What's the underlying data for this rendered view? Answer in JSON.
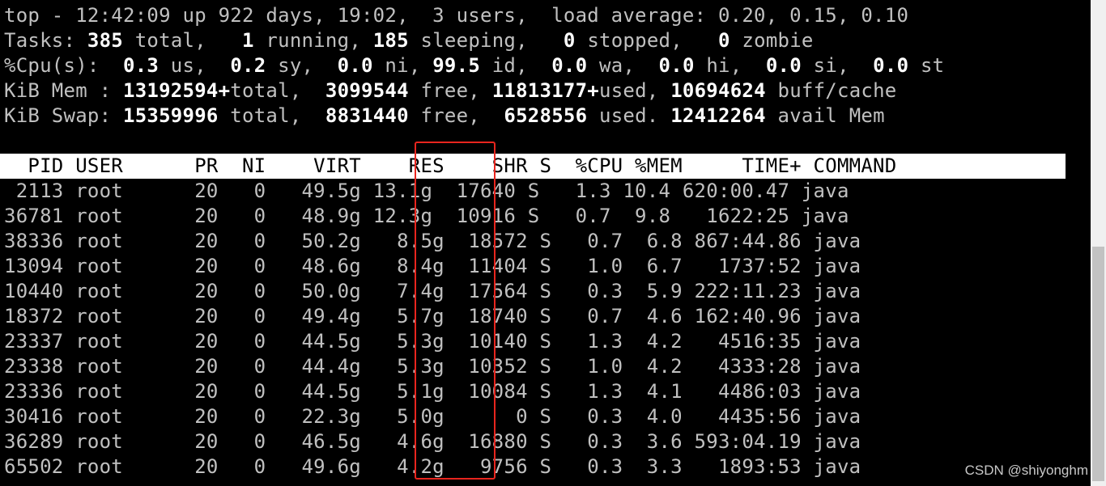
{
  "summary": {
    "uptime_line": "top - 12:42:09 up 922 days, 19:02,  3 users,  load average: 0.20, 0.15, 0.10",
    "tasks": {
      "label": "Tasks: ",
      "total": "385",
      "total_lbl": " total,   ",
      "running": "1",
      "running_lbl": " running, ",
      "sleeping": "185",
      "sleeping_lbl": " sleeping,   ",
      "stopped": "0",
      "stopped_lbl": " stopped,   ",
      "zombie": "0",
      "zombie_lbl": " zombie"
    },
    "cpu": {
      "label": "%Cpu(s):  ",
      "us": "0.3",
      "us_lbl": " us,  ",
      "sy": "0.2",
      "sy_lbl": " sy,  ",
      "ni": "0.0",
      "ni_lbl": " ni, ",
      "id": "99.5",
      "id_lbl": " id,  ",
      "wa": "0.0",
      "wa_lbl": " wa,  ",
      "hi": "0.0",
      "hi_lbl": " hi,  ",
      "si": "0.0",
      "si_lbl": " si,  ",
      "st": "0.0",
      "st_lbl": " st"
    },
    "mem": {
      "label": "KiB Mem : ",
      "total": "13192594+",
      "total_lbl": "total,  ",
      "free": "3099544",
      "free_lbl": " free, ",
      "used": "11813177+",
      "used_lbl": "used, ",
      "buff": "10694624",
      "buff_lbl": " buff/cache"
    },
    "swap": {
      "label": "KiB Swap: ",
      "total": "15359996",
      "total_lbl": " total,  ",
      "free": "8831440",
      "free_lbl": " free,  ",
      "used": "6528556",
      "used_lbl": " used. ",
      "avail": "12412264",
      "avail_lbl": " avail Mem"
    }
  },
  "table": {
    "header": "  PID USER      PR  NI    VIRT    RES    SHR S  %CPU %MEM     TIME+ COMMAND",
    "rows": [
      " 2113 root      20   0   49.5g 13.1g  17640 S   1.3 10.4 620:00.47 java",
      "36781 root      20   0   48.9g 12.3g  10916 S   0.7  9.8   1622:25 java",
      "38336 root      20   0   50.2g   8.5g  18572 S   0.7  6.8 867:44.86 java",
      "13094 root      20   0   48.6g   8.4g  11404 S   1.0  6.7   1737:52 java",
      "10440 root      20   0   50.0g   7.4g  17564 S   0.3  5.9 222:11.23 java",
      "18372 root      20   0   49.4g   5.7g  18740 S   0.7  4.6 162:40.96 java",
      "23337 root      20   0   44.5g   5.3g  10140 S   1.3  4.2   4516:35 java",
      "23338 root      20   0   44.4g   5.3g  10352 S   1.0  4.2   4333:28 java",
      "23336 root      20   0   44.5g   5.1g  10084 S   1.3  4.1   4486:03 java",
      "30416 root      20   0   22.3g   5.0g      0 S   0.3  4.0   4435:56 java",
      "36289 root      20   0   46.5g   4.6g  16880 S   0.3  3.6 593:04.19 java",
      "65502 root      20   0   49.6g   4.2g   9756 S   0.3  3.3   1893:53 java"
    ]
  },
  "watermark": "CSDN @shiyonghm",
  "colors": {
    "highlight": "#e8251e",
    "terminal_bg": "#000000",
    "header_bg": "#ffffff"
  }
}
